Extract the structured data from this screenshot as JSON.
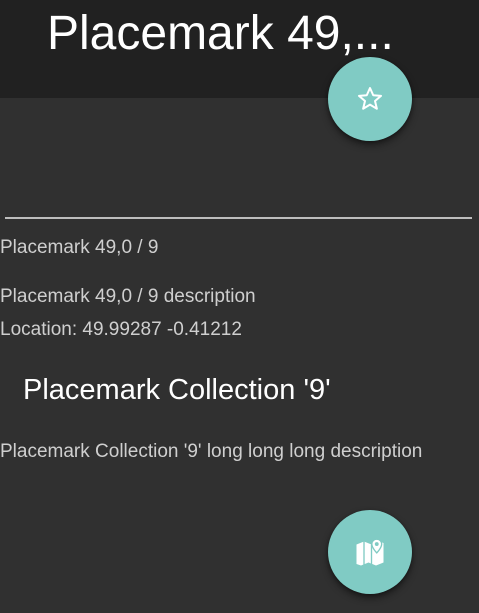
{
  "toolbar": {
    "title": "Placemark 49,..."
  },
  "fabs": {
    "favorite_icon": "star-outline-icon",
    "map_icon": "map-pin-icon"
  },
  "details": {
    "placemark_name": "Placemark 49,0 / 9",
    "placemark_description": "Placemark 49,0 / 9 description",
    "location": "Location: 49.99287 -0.41212"
  },
  "collection": {
    "title": "Placemark Collection '9'",
    "description": "Placemark Collection '9' long long long description"
  },
  "colors": {
    "background": "#303030",
    "toolbar": "#212121",
    "accent": "#80cbc4"
  }
}
